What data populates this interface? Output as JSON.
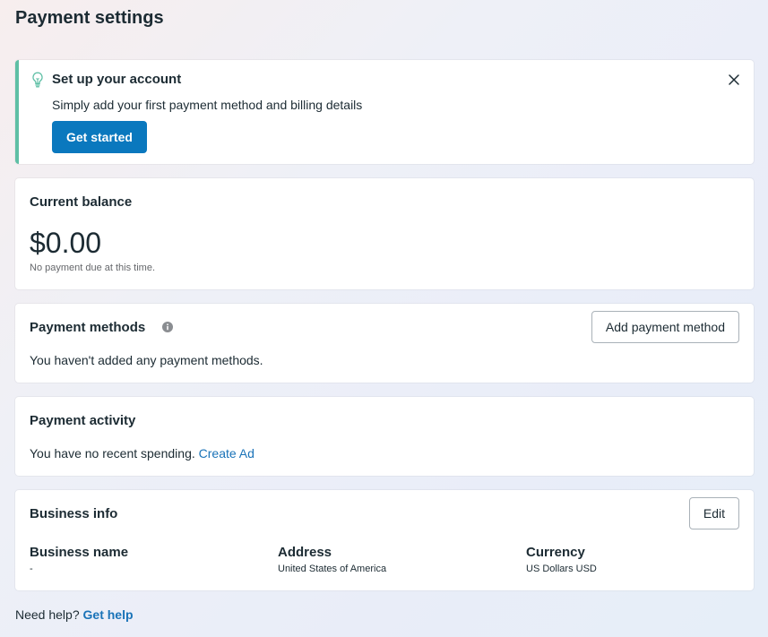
{
  "page": {
    "title": "Payment settings"
  },
  "setup": {
    "title": "Set up your account",
    "description": "Simply add your first payment method and billing details",
    "button_label": "Get started",
    "icons": {
      "lead": "lightbulb-icon",
      "close": "close-icon"
    },
    "accent_color": "#5ebfa5"
  },
  "balance": {
    "title": "Current balance",
    "amount": "$0.00",
    "note": "No payment due at this time."
  },
  "payment_methods": {
    "title": "Payment methods",
    "info_icon": "info-icon",
    "button_label": "Add payment method",
    "empty_text": "You haven't added any payment methods."
  },
  "activity": {
    "title": "Payment activity",
    "text": "You have no recent spending.",
    "link_label": "Create Ad"
  },
  "business": {
    "title": "Business info",
    "edit_label": "Edit",
    "fields": [
      {
        "label": "Business name",
        "value": "-"
      },
      {
        "label": "Address",
        "value": "United States of America"
      },
      {
        "label": "Currency",
        "value": "US Dollars USD"
      }
    ]
  },
  "help": {
    "text": "Need help?",
    "link_label": "Get help"
  },
  "colors": {
    "primary_button": "#0a78be",
    "link": "#1a73b8",
    "text": "#1c2b33"
  }
}
